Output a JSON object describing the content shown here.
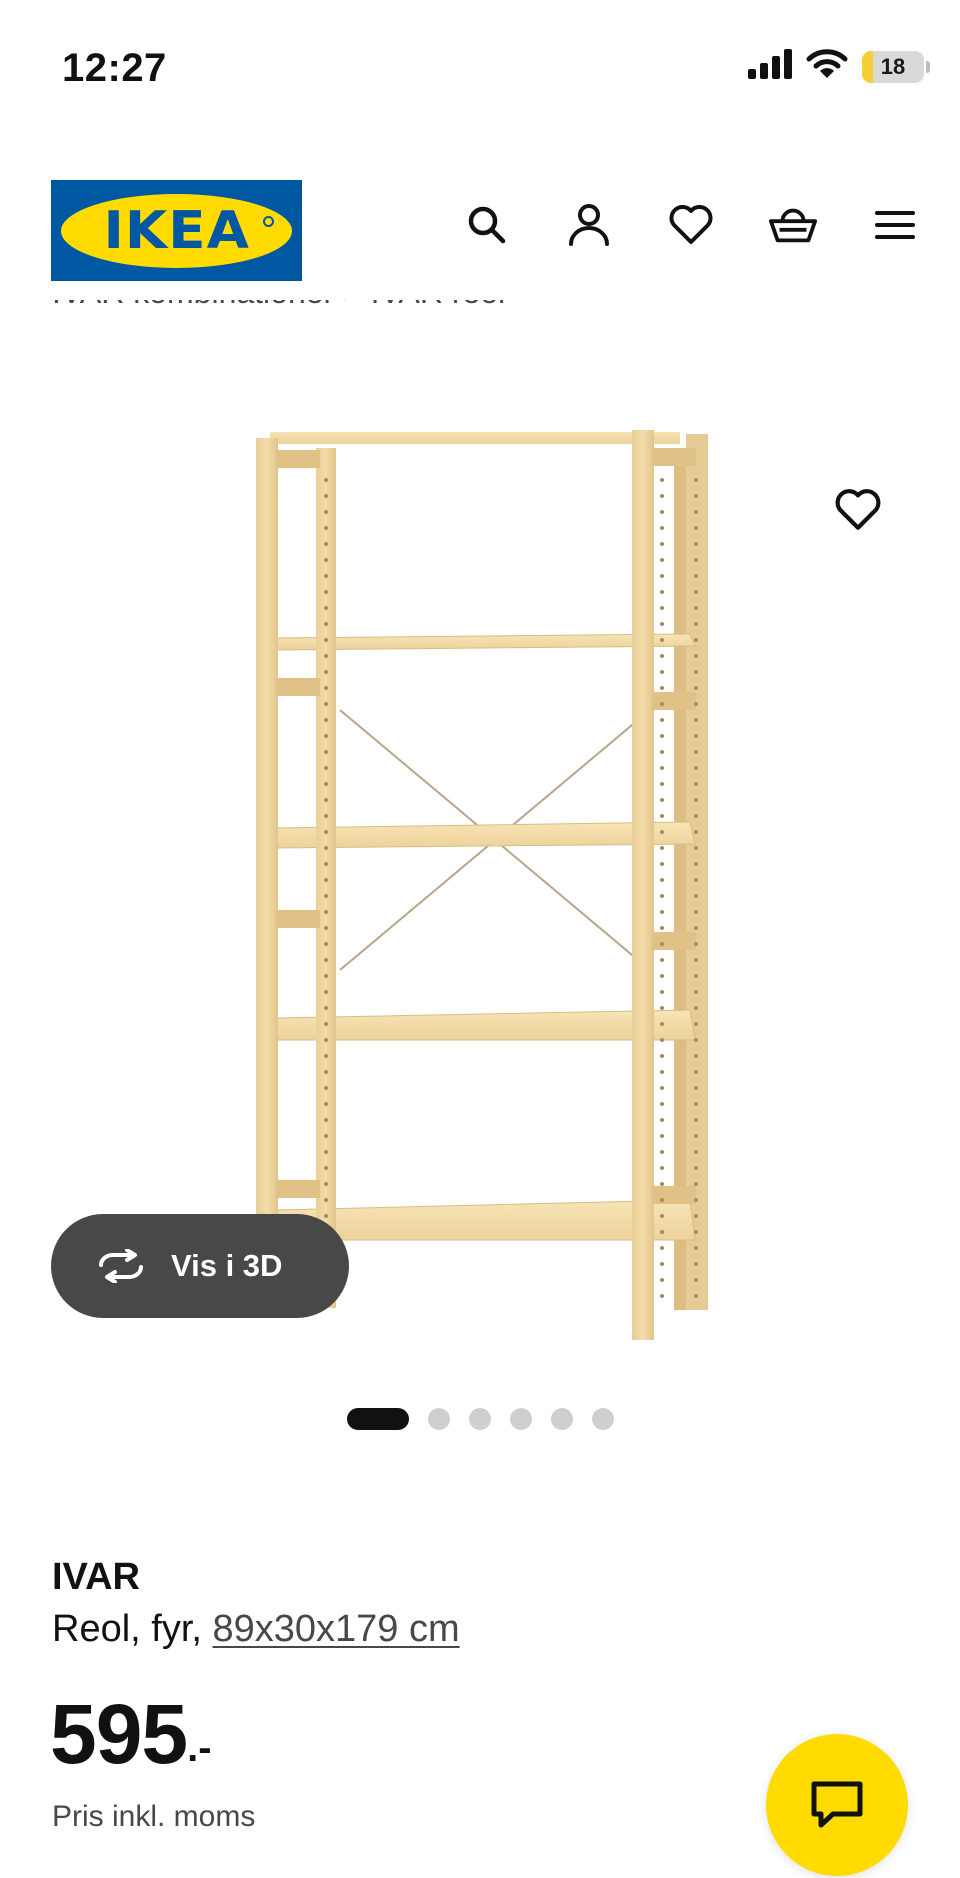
{
  "status_bar": {
    "time": "12:27",
    "battery_level": "18",
    "battery_fraction": 0.18,
    "battery_color": "#f4cf33",
    "icons": [
      "cellular-signal-icon",
      "wifi-icon",
      "battery-icon"
    ]
  },
  "header": {
    "logo_text": "IKEA",
    "brand_blue": "#0058a3",
    "brand_yellow": "#ffdb00",
    "nav_icons": [
      "search-icon",
      "account-icon",
      "heart-icon",
      "basket-icon",
      "menu-icon"
    ]
  },
  "breadcrumb": {
    "text": "IVAR kombinationer  >  IVAR reol"
  },
  "gallery": {
    "image_count": 6,
    "active_index": 0,
    "view3d_label": "Vis i 3D",
    "favorite_icon": "heart-icon"
  },
  "product": {
    "name": "IVAR",
    "desc_prefix": "Reol, fyr, ",
    "measure": "89x30x179 cm",
    "price_int": "595",
    "price_suffix": ".-",
    "price_note": "Pris inkl. moms"
  },
  "chat": {
    "icon": "chat-icon"
  }
}
